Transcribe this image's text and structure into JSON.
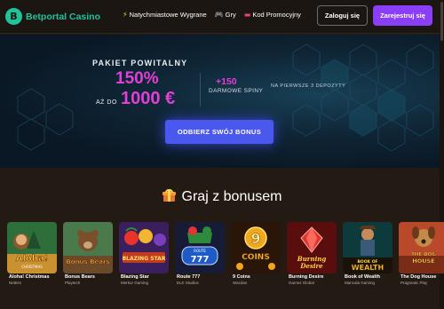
{
  "header": {
    "logo_letter": "B",
    "brand": "Betportal Casino",
    "nav": [
      {
        "label": "Natychmiastowe Wygrane",
        "icon": "lightning-icon"
      },
      {
        "label": "Gry",
        "icon": "gamepad-icon"
      },
      {
        "label": "Kod Promocyjny",
        "icon": "ticket-icon"
      }
    ],
    "login_label": "Zaloguj się",
    "register_label": "Zarejestruj się"
  },
  "hero": {
    "package_label": "PAKIET POWITALNY",
    "percent": "150%",
    "upto_label": "AŻ DO",
    "amount": "1000 €",
    "spins_count": "+150",
    "spins_label": "DARMOWE SPINY",
    "deposits_note": "NA PIERWSZE 3 DEPOZYTY",
    "claim_label": "ODBIERZ SWÓJ BONUS"
  },
  "section": {
    "title": "Graj z bonusem",
    "icon": "gift-icon"
  },
  "games": [
    {
      "name": "Aloha! Christmas",
      "provider": "NetEnt"
    },
    {
      "name": "Bonus Bears",
      "provider": "Playtech"
    },
    {
      "name": "Blazing Star",
      "provider": "Merkur Gaming"
    },
    {
      "name": "Route 777",
      "provider": "ELK Studios"
    },
    {
      "name": "9 Coins",
      "provider": "Wazdan"
    },
    {
      "name": "Burning Desire",
      "provider": "Games Global"
    },
    {
      "name": "Book of Wealth",
      "provider": "Mancala Gaming"
    },
    {
      "name": "The Dog House",
      "provider": "Pragmatic Play"
    }
  ],
  "thumb_text": {
    "aloha_logo": "Aloha!",
    "aloha_sub": "CHRISTMAS",
    "bears_logo": "Bonus Bears",
    "blazing_logo": "BLAZING STAR",
    "route_logo": "777",
    "route_small": "ROUTE",
    "coins_big": "9",
    "coins_logo": "COINS",
    "burning_top": "Burning",
    "burning_bottom": "Desire",
    "wealth_top": "BOOK OF",
    "wealth_bottom": "WEALTH",
    "dog_top": "THE DOG",
    "dog_bottom": "HOUSE"
  },
  "colors": {
    "brand": "#20c39a",
    "accent_purple": "#8a3ef5",
    "promo_magenta": "#e23fd6",
    "cta_blue": "#4b58ee",
    "background": "#241a14"
  }
}
